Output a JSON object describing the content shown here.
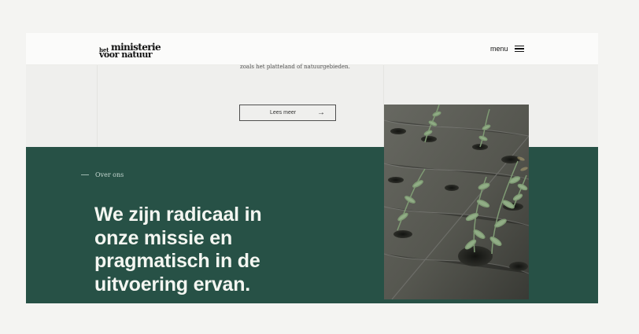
{
  "header": {
    "logo": {
      "small": "het",
      "top": "ministerie",
      "bottom": "voor natuur"
    },
    "menu_label": "menu",
    "menu_icon": "hamburger-icon"
  },
  "intro": {
    "text": "zoals het platteland of natuurgebieden.",
    "button_label": "Lees meer",
    "button_icon": "arrow-right-icon",
    "arrow_glyph": "→"
  },
  "about": {
    "label": "Over ons",
    "headline": "We zijn radicaal in onze missie en pragmatisch in de uitvoering ervan."
  },
  "colors": {
    "accent_green": "#275146",
    "page_background": "#f4f4f2"
  }
}
